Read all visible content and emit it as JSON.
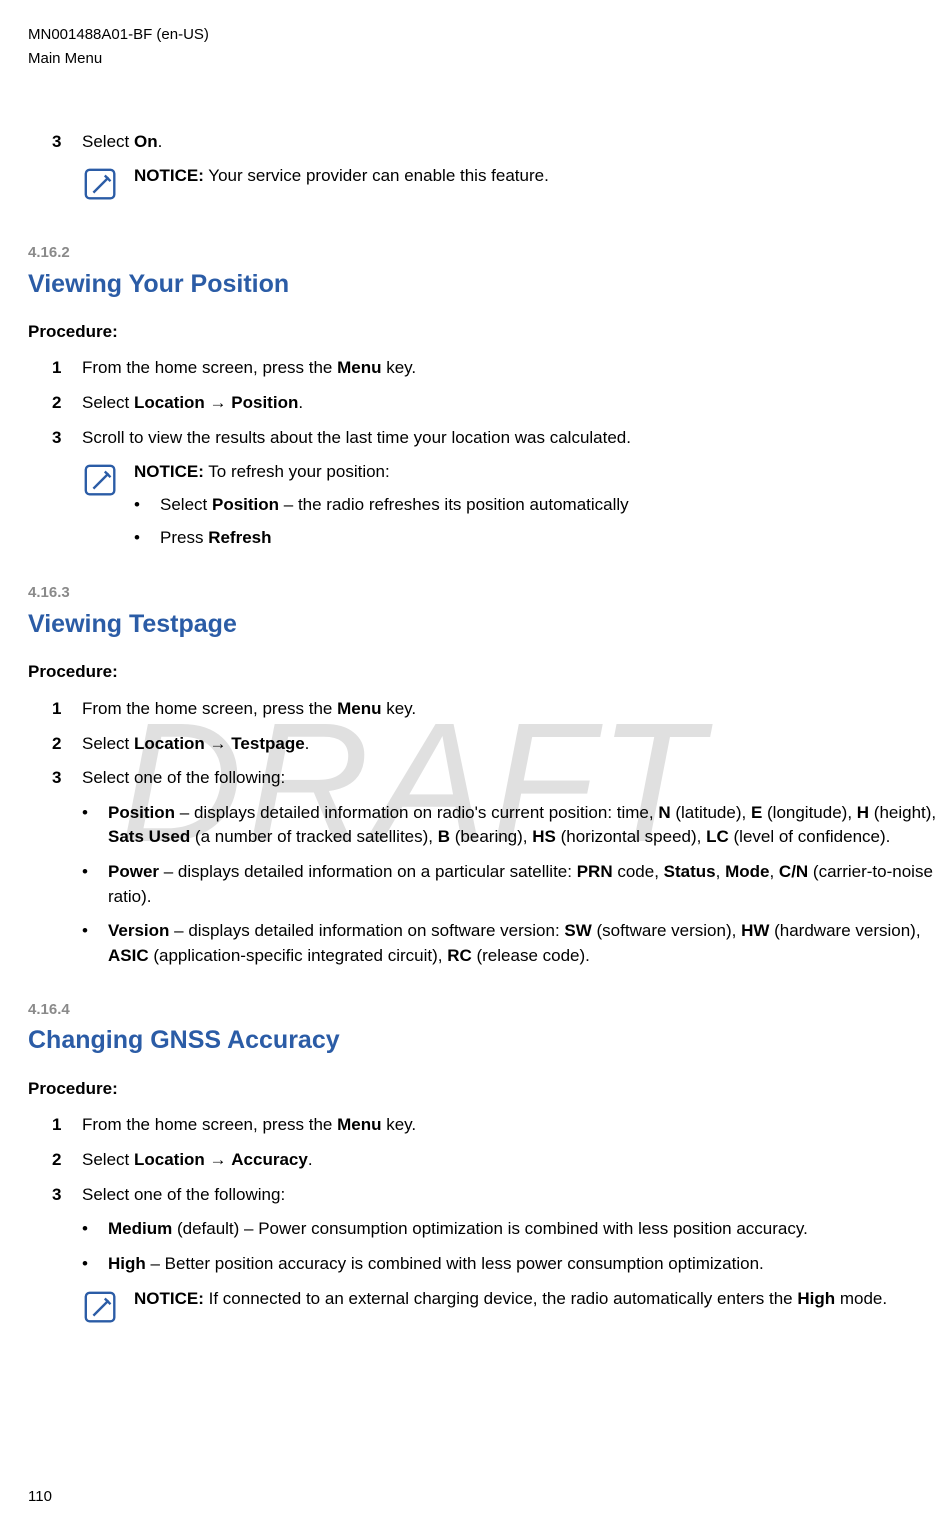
{
  "header": {
    "doc_id": "MN001488A01-BF (en-US)",
    "section": "Main Menu"
  },
  "watermark": "DRAFT",
  "page_number": "110",
  "intro_step": {
    "num": "3",
    "pre": "Select ",
    "bold": "On",
    "post": "."
  },
  "intro_notice": {
    "label": "NOTICE:",
    "text": " Your service provider can enable this feature."
  },
  "sec1": {
    "num": "4.16.2",
    "title": "Viewing Your Position",
    "procedure": "Procedure:",
    "step1": {
      "num": "1",
      "pre": "From the home screen, press the ",
      "bold": "Menu",
      "post": " key."
    },
    "step2": {
      "num": "2",
      "pre": "Select ",
      "b1": "Location",
      "arrow": " → ",
      "b2": "Position",
      "post": "."
    },
    "step3": {
      "num": "3",
      "text": "Scroll to view the results about the last time your location was calculated."
    },
    "notice": {
      "label": "NOTICE:",
      "text": " To refresh your position:",
      "b1_pre": "Select ",
      "b1_bold": "Position",
      "b1_post": " – the radio refreshes its position automatically",
      "b2_pre": "Press ",
      "b2_bold": "Refresh"
    }
  },
  "sec2": {
    "num": "4.16.3",
    "title": "Viewing Testpage",
    "procedure": "Procedure:",
    "step1": {
      "num": "1",
      "pre": "From the home screen, press the ",
      "bold": "Menu",
      "post": " key."
    },
    "step2": {
      "num": "2",
      "pre": "Select ",
      "b1": "Location",
      "arrow": " → ",
      "b2": "Testpage",
      "post": "."
    },
    "step3": {
      "num": "3",
      "text": "Select one of the following:"
    },
    "bullet1": {
      "b1": "Position",
      "t1": " – displays detailed information on radio's current position: time, ",
      "b2": "N",
      "t2": " (latitude), ",
      "b3": "E",
      "t3": " (longitude), ",
      "b4": "H",
      "t4": " (height), ",
      "b5": "Sats Used",
      "t5": " (a number of tracked satellites), ",
      "b6": "B",
      "t6": " (bearing), ",
      "b7": "HS",
      "t7": " (horizontal speed), ",
      "b8": "LC",
      "t8": " (level of confidence)."
    },
    "bullet2": {
      "b1": "Power",
      "t1": " – displays detailed information on a particular satellite: ",
      "b2": "PRN",
      "t2": " code, ",
      "b3": "Status",
      "t3": ", ",
      "b4": "Mode",
      "t4": ", ",
      "b5": "C/N",
      "t5": " (carrier-to-noise ratio)."
    },
    "bullet3": {
      "b1": "Version",
      "t1": " – displays detailed information on software version: ",
      "b2": "SW",
      "t2": " (software version), ",
      "b3": "HW",
      "t3": " (hardware version), ",
      "b4": "ASIC",
      "t4": " (application-specific integrated circuit), ",
      "b5": "RC",
      "t5": " (release code)."
    }
  },
  "sec3": {
    "num": "4.16.4",
    "title": "Changing GNSS Accuracy",
    "procedure": "Procedure:",
    "step1": {
      "num": "1",
      "pre": "From the home screen, press the ",
      "bold": "Menu",
      "post": " key."
    },
    "step2": {
      "num": "2",
      "pre": "Select ",
      "b1": "Location",
      "arrow": " → ",
      "b2": "Accuracy",
      "post": "."
    },
    "step3": {
      "num": "3",
      "text": "Select one of the following:"
    },
    "bullet1": {
      "b1": "Medium",
      "t1": " (default) – Power consumption optimization is combined with less position accuracy."
    },
    "bullet2": {
      "b1": "High",
      "t1": " – Better position accuracy is combined with less power consumption optimization."
    },
    "notice": {
      "label": "NOTICE:",
      "t1": " If connected to an external charging device, the radio automatically enters the ",
      "b1": "High",
      "t2": " mode."
    }
  }
}
